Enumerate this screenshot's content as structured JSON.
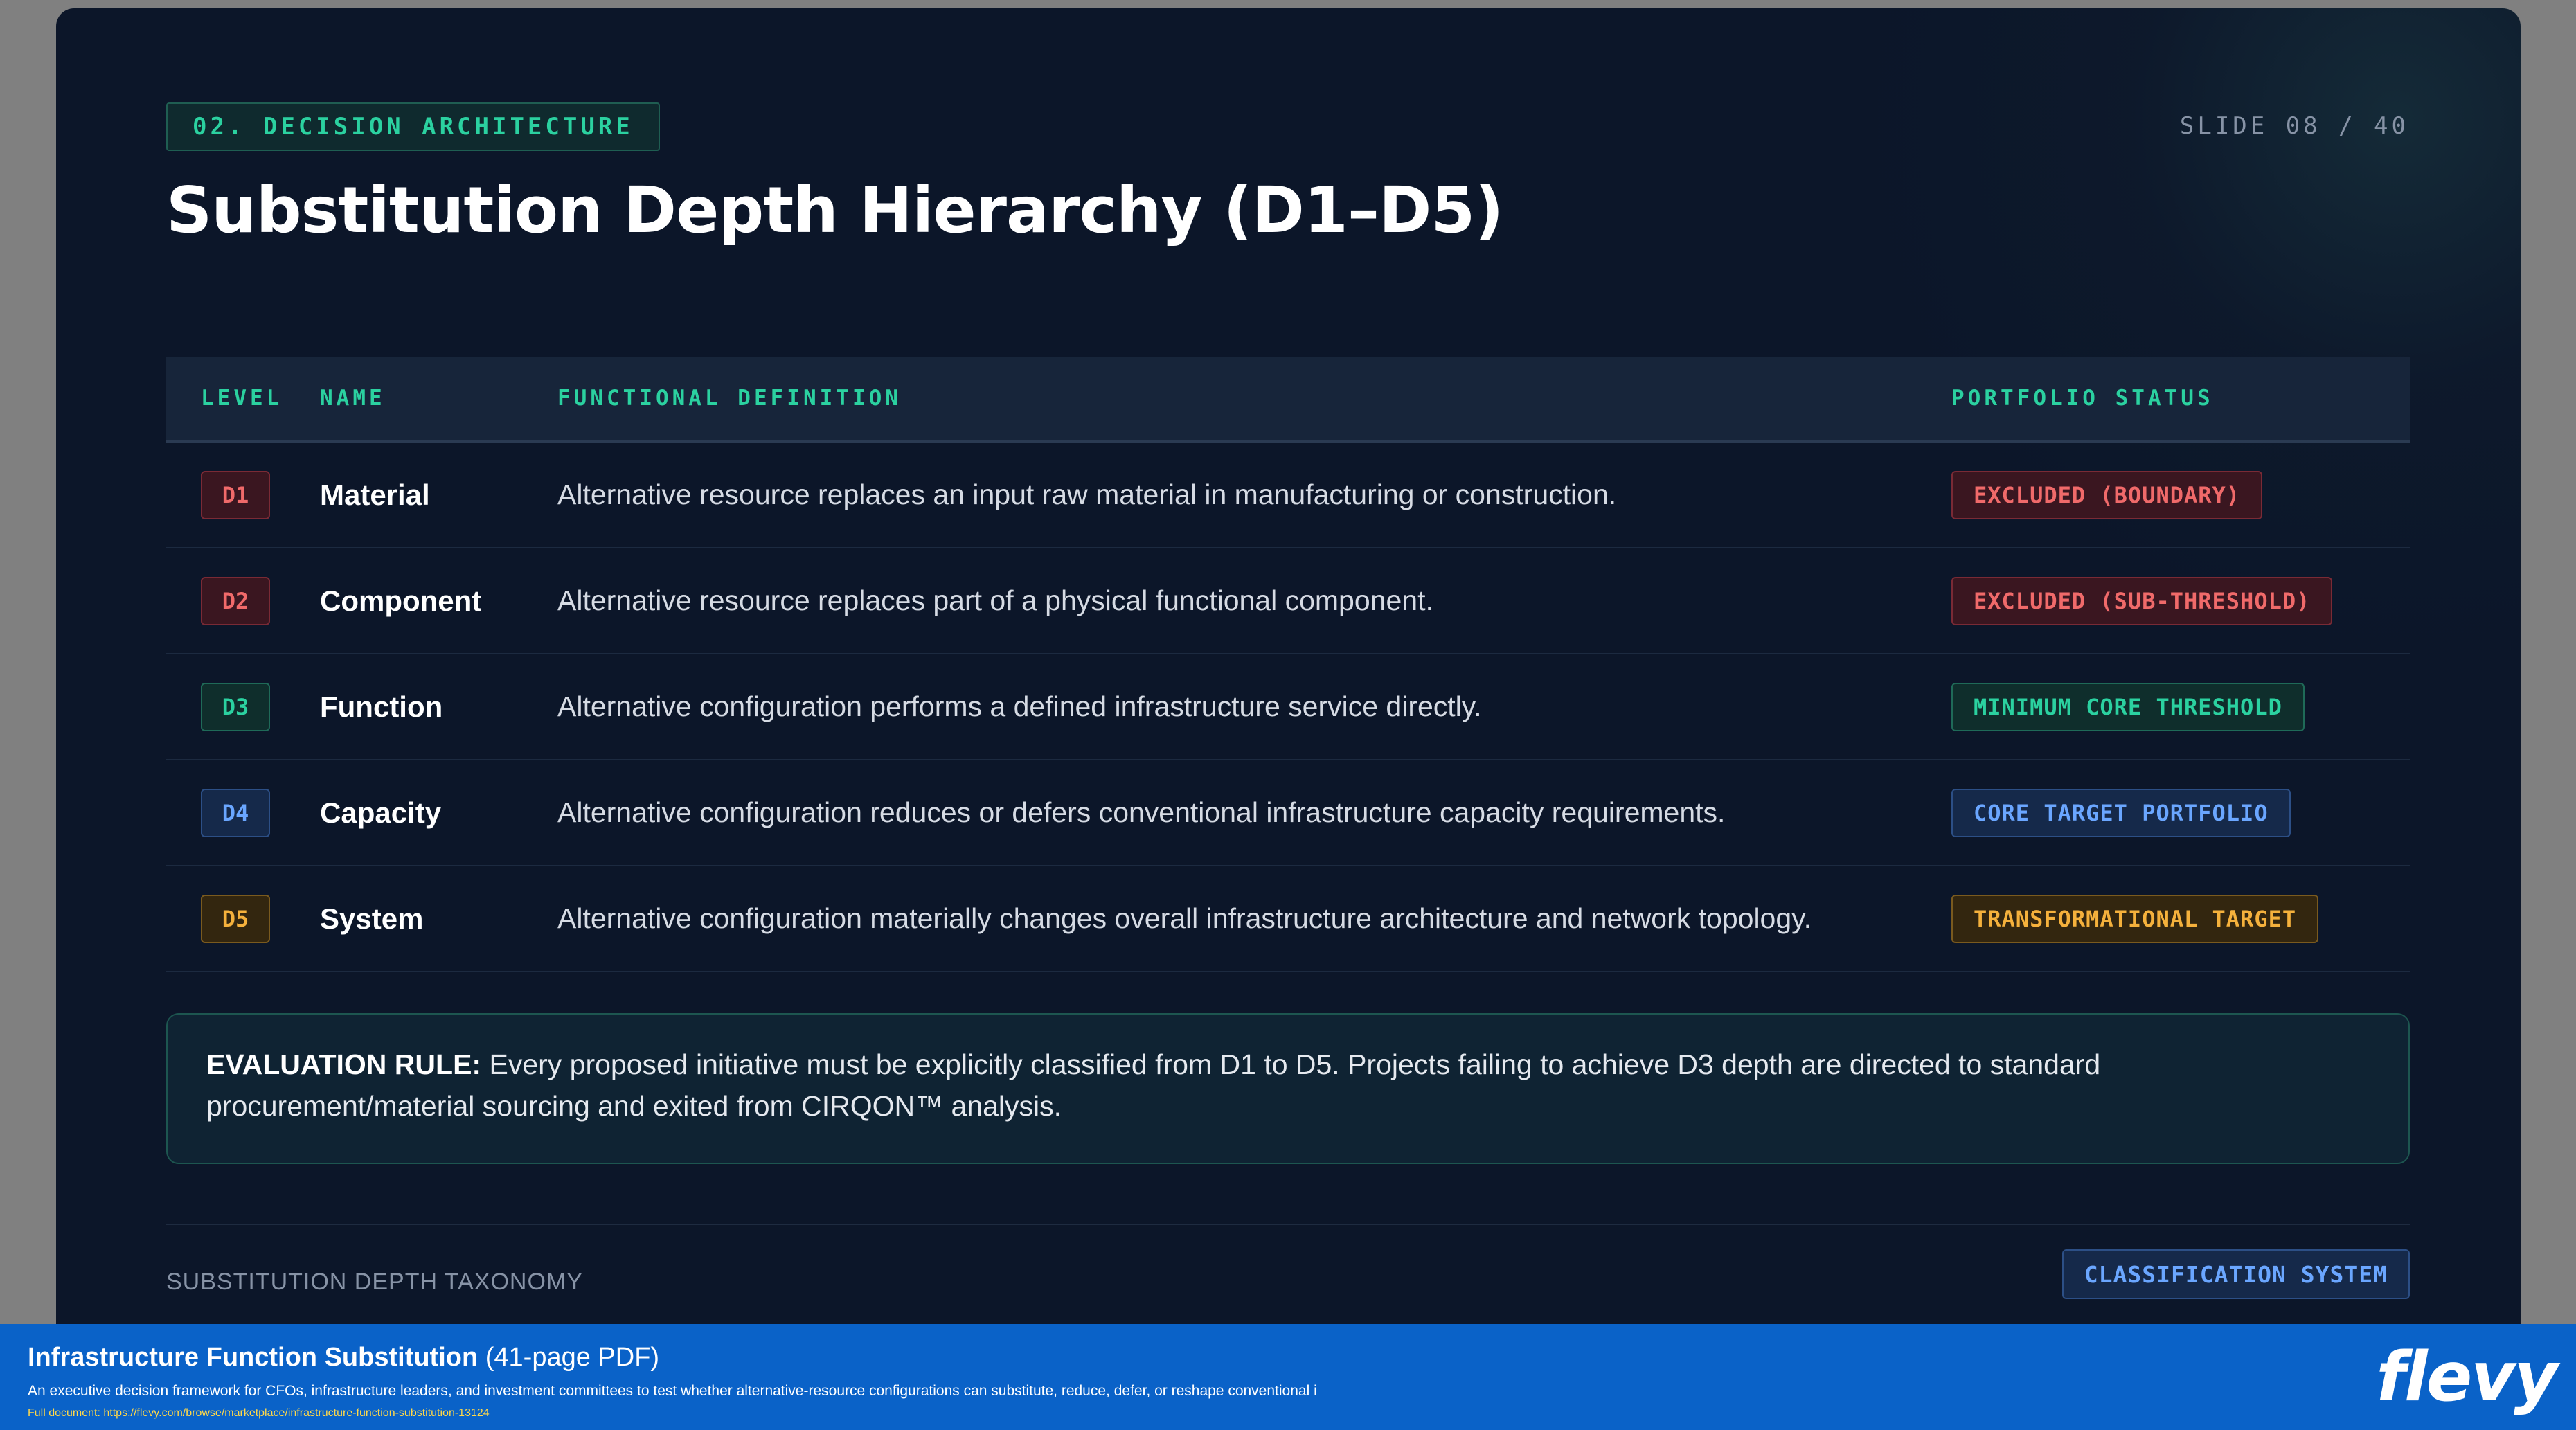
{
  "slide": {
    "section_tag": "02. DECISION ARCHITECTURE",
    "slide_number": "SLIDE 08 / 40",
    "title": "Substitution Depth Hierarchy (D1–D5)"
  },
  "table": {
    "headers": [
      "LEVEL",
      "NAME",
      "FUNCTIONAL DEFINITION",
      "PORTFOLIO STATUS"
    ],
    "rows": [
      {
        "level": "D1",
        "name": "Material",
        "definition": "Alternative resource replaces an input raw material in manufacturing or construction.",
        "status": "EXCLUDED (BOUNDARY)",
        "tone": "red"
      },
      {
        "level": "D2",
        "name": "Component",
        "definition": "Alternative resource replaces part of a physical functional component.",
        "status": "EXCLUDED (SUB-THRESHOLD)",
        "tone": "red"
      },
      {
        "level": "D3",
        "name": "Function",
        "definition": "Alternative configuration performs a defined infrastructure service directly.",
        "status": "MINIMUM CORE THRESHOLD",
        "tone": "green"
      },
      {
        "level": "D4",
        "name": "Capacity",
        "definition": "Alternative configuration reduces or defers conventional infrastructure capacity requirements.",
        "status": "CORE TARGET PORTFOLIO",
        "tone": "blue"
      },
      {
        "level": "D5",
        "name": "System",
        "definition": "Alternative configuration materially changes overall infrastructure architecture and network topology.",
        "status": "TRANSFORMATIONAL TARGET",
        "tone": "amber"
      }
    ]
  },
  "rule": {
    "label": "EVALUATION RULE:",
    "text": " Every proposed initiative must be explicitly classified from D1 to D5. Projects failing to achieve D3 depth are directed to standard procurement/material sourcing and exited from CIRQON™ analysis."
  },
  "footer": {
    "label": "SUBSTITUTION DEPTH TAXONOMY",
    "badge": "CLASSIFICATION SYSTEM"
  },
  "banner": {
    "title": "Infrastructure Function Substitution",
    "pages": " (41-page PDF)",
    "description": "An executive decision framework for CFOs, infrastructure leaders, and investment committees to test whether alternative-resource configurations can substitute, reduce, defer, or reshape conventional i",
    "link": "Full document: https://flevy.com/browse/marketplace/infrastructure-function-substitution-13124",
    "logo": "flevy"
  }
}
